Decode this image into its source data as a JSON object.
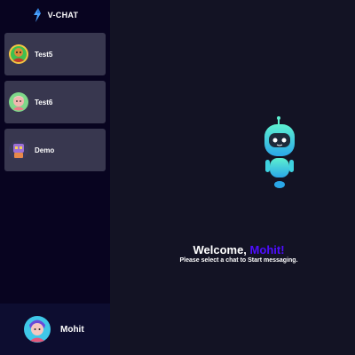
{
  "app": {
    "name": "V-CHAT"
  },
  "contacts": [
    {
      "name": "Test5",
      "avatar": "avatar-green-icon"
    },
    {
      "name": "Test6",
      "avatar": "avatar-pink-icon"
    },
    {
      "name": "Demo",
      "avatar": "avatar-robot-icon"
    }
  ],
  "current_user": {
    "name": "Mohit"
  },
  "welcome": {
    "greeting": "Welcome,",
    "user": "Mohit!",
    "subtitle": "Please select a chat to Start messaging."
  },
  "colors": {
    "sidebar_bg": "#080420",
    "contact_bg": "#38374f",
    "main_bg": "#131324",
    "accent": "#4e0eff",
    "robot": "#2fe0c0"
  }
}
